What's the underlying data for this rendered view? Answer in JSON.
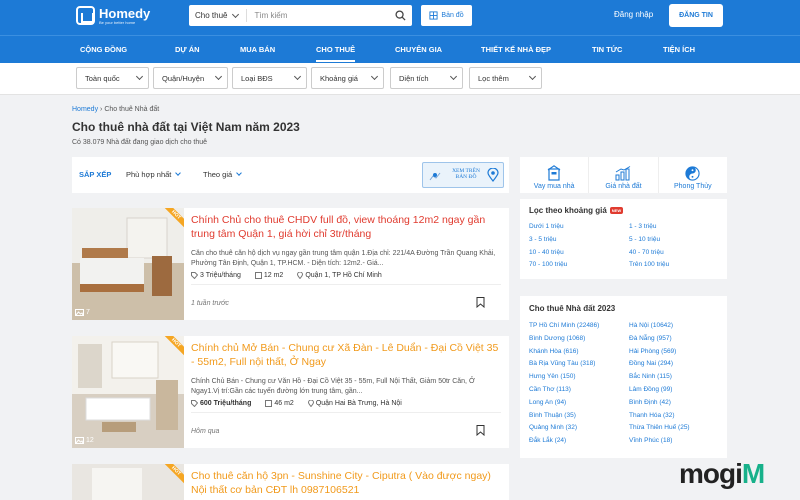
{
  "header": {
    "logo_name": "Homedy",
    "logo_tagline": "Be your better home",
    "search_type": "Cho thuê",
    "search_placeholder": "Tìm kiếm",
    "map_button": "Bản đồ",
    "login": "Đăng nhập",
    "post_button": "ĐĂNG TIN"
  },
  "nav": {
    "items": [
      "CỘNG ĐỒNG",
      "DỰ ÁN",
      "MUA BÁN",
      "CHO THUÊ",
      "CHUYÊN GIA",
      "THIẾT KẾ NHÀ ĐẸP",
      "TIN TỨC",
      "TIỆN ÍCH"
    ],
    "active": "CHO THUÊ"
  },
  "filters": [
    "Toàn quốc",
    "Quận/Huyện",
    "Loại BĐS",
    "Khoảng giá",
    "Diện tích",
    "Lọc thêm"
  ],
  "breadcrumb": {
    "home": "Homedy",
    "separator": "›",
    "current": "Cho thuê Nhà đất"
  },
  "page": {
    "title": "Cho thuê nhà đất tại Việt Nam năm 2023",
    "subtitle": "Có 38.079 Nhà đất đang giao dịch cho thuê"
  },
  "sort": {
    "label": "SẮP XẾP",
    "relevance": "Phù hợp nhất",
    "price": "Theo giá",
    "map_card": "XEM TRÊN BẢN ĐỒ"
  },
  "listings": [
    {
      "badge": "HOT",
      "title": "Chính Chủ cho thuê CHDV full đồ, view thoáng 12m2 ngay gần trung tâm Quận 1, giá hời chỉ 3tr/tháng",
      "desc": "Căn cho thuê căn hộ dịch vụ ngay gần trung tâm quận 1.Địa chỉ: 221/4A Đường Trần Quang Khải, Phường Tân Định, Quận 1, TP.HCM. - Diện tích: 12m2.- Giá...",
      "price": "3 Triệu/tháng",
      "area": "12 m2",
      "location": "Quận 1, TP Hồ Chí Minh",
      "posted": "1 tuần trước",
      "photos": "7",
      "title_color": "#e03b2f"
    },
    {
      "badge": "HOT",
      "title": "Chính chủ Mở Bán - Chung cư Xã Đàn - Lê Duẩn - Đại Cồ Việt 35 - 55m2, Full nội thất, Ở Ngay",
      "desc": "Chính Chủ Bán - Chung cư Văn Hồ - Đại Cồ Việt 35 - 55m, Full Nội Thất, Giảm 50tr Căn, Ở Ngay1.Vị trí:Gần các tuyến đường lớn trung tâm, gần...",
      "price": "600 Triệu/tháng",
      "area": "46 m2",
      "location": "Quận Hai Bà Trưng, Hà Nội",
      "posted": "Hôm qua",
      "photos": "12",
      "title_color": "#f19a1c"
    },
    {
      "badge": "HOT",
      "title": "Cho thuê căn hộ 3pn - Sunshine City - Ciputra ( Vào được ngay) Nội thất cơ bản CĐT lh 0987106521",
      "title_color": "#f19a1c"
    }
  ],
  "tools": [
    {
      "label": "Vay mua nhà",
      "icon": "calculator-house-icon"
    },
    {
      "label": "Giá nhà đất",
      "icon": "price-chart-icon"
    },
    {
      "label": "Phong Thủy",
      "icon": "yin-yang-icon"
    }
  ],
  "price_filter": {
    "title": "Lọc theo khoảng giá",
    "badge": "NEW",
    "links": [
      "Dưới 1 triệu",
      "1 - 3 triệu",
      "3 - 5 triệu",
      "5 - 10 triệu",
      "10 - 40 triệu",
      "40 - 70 triệu",
      "70 - 100 triệu",
      "Trên 100 triệu"
    ]
  },
  "region": {
    "title": "Cho thuê Nhà đất 2023",
    "links": [
      "TP Hồ Chí Minh (22486)",
      "Hà Nội (10642)",
      "Bình Dương (1068)",
      "Đà Nẵng (957)",
      "Khánh Hòa (616)",
      "Hải Phòng (569)",
      "Bà Rịa Vũng Tàu (318)",
      "Đồng Nai (294)",
      "Hưng Yên (150)",
      "Bắc Ninh (115)",
      "Cần Thơ (113)",
      "Lâm Đồng (99)",
      "Long An (94)",
      "Bình Định (42)",
      "Bình Thuận (35)",
      "Thanh Hóa (32)",
      "Quảng Ninh (32)",
      "Thừa Thiên Huế (25)",
      "Đắk Lắk (24)",
      "Vĩnh Phúc (18)"
    ]
  },
  "watermark": "mogi"
}
